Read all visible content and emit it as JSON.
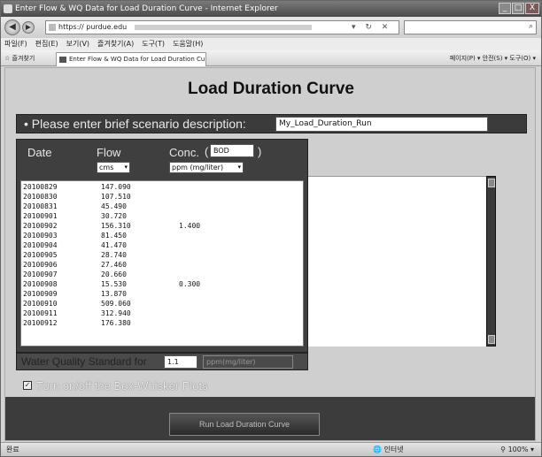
{
  "window": {
    "title": "Enter Flow & WQ Data for Load Duration Curve - Internet Explorer",
    "controls": {
      "minimize": "_",
      "maximize": "□",
      "close": "X"
    }
  },
  "address_bar": {
    "url": "https://",
    "url_domain": "purdue.edu",
    "back_icon": "back-arrow-icon",
    "forward_icon": "forward-arrow-icon"
  },
  "menu_bar": {
    "items": [
      "파일(F)",
      "편집(E)",
      "보기(V)",
      "즐겨찾기(A)",
      "도구(T)",
      "도움말(H)"
    ]
  },
  "command_bar": {
    "favorites_label": "즐겨찾기",
    "tab_title": "Enter Flow & WQ Data for Load Duration Curve",
    "right_items": "페이지(P) ▾  안전(S) ▾  도구(O) ▾"
  },
  "page": {
    "title": "Load Duration Curve",
    "scenario": {
      "label": "Please enter brief scenario description:",
      "value": "My_Load_Duration_Run"
    },
    "columns": {
      "date": "Date",
      "flow": "Flow",
      "conc": "Conc.",
      "conc_paren_open": "(",
      "conc_paren_close": ")",
      "parameter": "BOD",
      "flow_unit": "cms",
      "conc_unit": "ppm (mg/liter)"
    },
    "rows": [
      {
        "date": "20100829",
        "flow": "147.090",
        "conc": ""
      },
      {
        "date": "20100830",
        "flow": "107.510",
        "conc": ""
      },
      {
        "date": "20100831",
        "flow": "45.490",
        "conc": ""
      },
      {
        "date": "20100901",
        "flow": "30.720",
        "conc": ""
      },
      {
        "date": "20100902",
        "flow": "156.310",
        "conc": "1.400"
      },
      {
        "date": "20100903",
        "flow": "81.450",
        "conc": ""
      },
      {
        "date": "20100904",
        "flow": "41.470",
        "conc": ""
      },
      {
        "date": "20100905",
        "flow": "28.740",
        "conc": ""
      },
      {
        "date": "20100906",
        "flow": "27.460",
        "conc": ""
      },
      {
        "date": "20100907",
        "flow": "20.660",
        "conc": ""
      },
      {
        "date": "20100908",
        "flow": "15.530",
        "conc": "0.300"
      },
      {
        "date": "20100909",
        "flow": "13.870",
        "conc": ""
      },
      {
        "date": "20100910",
        "flow": "509.060",
        "conc": ""
      },
      {
        "date": "20100911",
        "flow": "312.940",
        "conc": ""
      },
      {
        "date": "20100912",
        "flow": "176.380",
        "conc": ""
      }
    ],
    "water_quality_standard": {
      "label": "Water Quality Standard for",
      "value": "1.1",
      "unit": "ppm(mg/liter)"
    },
    "box_whisker": {
      "label": "Turn on/off the Box-Whisker Plots",
      "checked": true
    },
    "run_button": "Run Load Duration Curve"
  },
  "status_bar": {
    "left": "완료",
    "zone": "인터넷",
    "zoom": "100%"
  }
}
